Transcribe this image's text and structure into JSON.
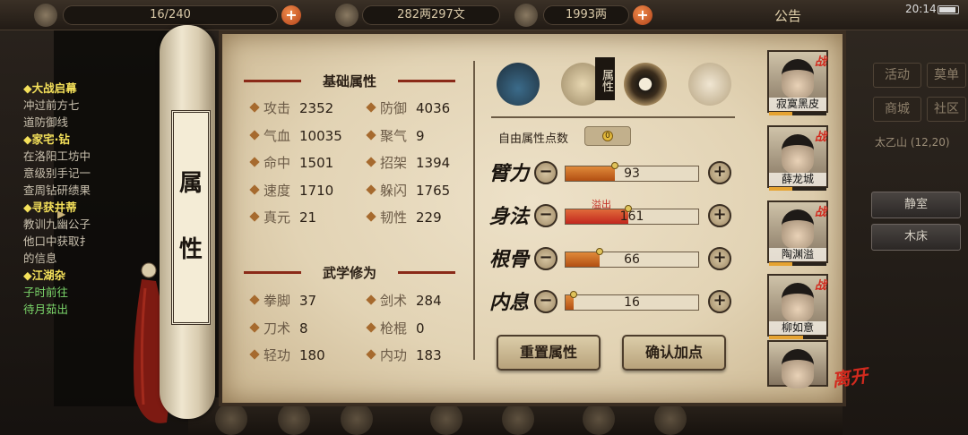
{
  "topbar": {
    "capacity": "16/240",
    "silver": "282两297文",
    "gold": "1993两",
    "announce": "公告",
    "clock": "20:14"
  },
  "quests": [
    {
      "text": "◆大战启幕",
      "style": "h"
    },
    {
      "text": "冲过前方七",
      "style": "b"
    },
    {
      "text": "道防御线",
      "style": "b"
    },
    {
      "text": "◆家宅·钻",
      "style": "h"
    },
    {
      "text": "在洛阳工坊中",
      "style": "b"
    },
    {
      "text": "意级别手记一",
      "style": "b"
    },
    {
      "text": "查周钻研绩果",
      "style": "b"
    },
    {
      "text": "◆寻获井蒂",
      "style": "h"
    },
    {
      "text": "教训九幽公子",
      "style": "b"
    },
    {
      "text": "他口中获取扌",
      "style": "b"
    },
    {
      "text": "的信息",
      "style": "b"
    },
    {
      "text": "◆江湖杂",
      "style": "h"
    },
    {
      "text": "子时前往",
      "style": "g"
    },
    {
      "text": "待月茹出",
      "style": "g"
    }
  ],
  "right_panel": {
    "buttons": [
      "活动",
      "商城",
      "莫单",
      "社区"
    ],
    "location": "太乙山 (12,20)",
    "rooms": [
      "静室",
      "木床"
    ]
  },
  "scroll_label": [
    "属",
    "性"
  ],
  "basic": {
    "title": "基础属性",
    "stats": [
      {
        "name": "攻击",
        "value": "2352"
      },
      {
        "name": "防御",
        "value": "4036"
      },
      {
        "name": "气血",
        "value": "10035"
      },
      {
        "name": "聚气",
        "value": "9"
      },
      {
        "name": "命中",
        "value": "1501"
      },
      {
        "name": "招架",
        "value": "1394"
      },
      {
        "name": "速度",
        "value": "1710"
      },
      {
        "name": "躲闪",
        "value": "1765"
      },
      {
        "name": "真元",
        "value": "21"
      },
      {
        "name": "韧性",
        "value": "229"
      }
    ]
  },
  "martial": {
    "title": "武学修为",
    "stats": [
      {
        "name": "拳脚",
        "value": "37"
      },
      {
        "name": "剑术",
        "value": "284"
      },
      {
        "name": "刀术",
        "value": "8"
      },
      {
        "name": "枪棍",
        "value": "0"
      },
      {
        "name": "轻功",
        "value": "180"
      },
      {
        "name": "内功",
        "value": "183"
      }
    ]
  },
  "attr_tab_label": "属性",
  "free_points": {
    "label": "自由属性点数",
    "value": "0"
  },
  "attributes": [
    {
      "label": "臂力",
      "value": "93",
      "fill": 0.37
    },
    {
      "label": "身法",
      "value": "161",
      "fill": 0.47,
      "overflow": "溢出"
    },
    {
      "label": "根骨",
      "value": "66",
      "fill": 0.26
    },
    {
      "label": "内息",
      "value": "16",
      "fill": 0.06
    }
  ],
  "reset_label": "重置属性",
  "confirm_label": "确认加点",
  "party": [
    {
      "name": "寂寞黑皮",
      "tag": "战"
    },
    {
      "name": "薛龙城",
      "tag": "战"
    },
    {
      "name": "陶渊溢",
      "tag": "战"
    },
    {
      "name": "柳如意",
      "tag": "战"
    },
    {
      "name": "",
      "tag": ""
    }
  ],
  "leave_label": "离开",
  "colors": {
    "accent_red": "#d22a1e",
    "bar_orange": "#e08a3a",
    "paper": "#e2d3b4"
  }
}
